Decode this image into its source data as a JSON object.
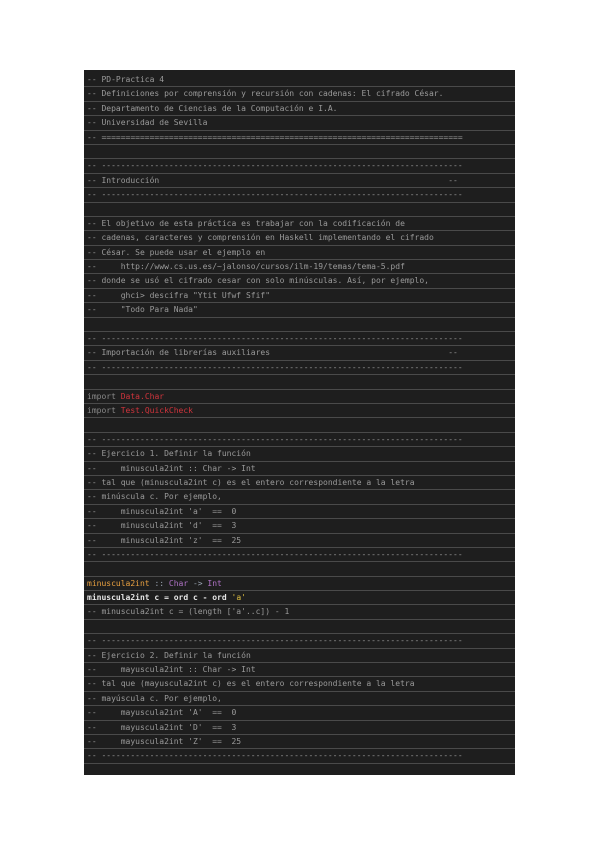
{
  "lines": [
    {
      "type": "comment",
      "text": "-- PD-Practica 4"
    },
    {
      "type": "comment",
      "text": "-- Definiciones por comprensión y recursión con cadenas: El cifrado César."
    },
    {
      "type": "comment",
      "text": "-- Departamento de Ciencias de la Computación e I.A."
    },
    {
      "type": "comment",
      "text": "-- Universidad de Sevilla"
    },
    {
      "type": "comment",
      "text": "-- ==========================================================================="
    },
    {
      "type": "blank",
      "text": ""
    },
    {
      "type": "comment",
      "text": "-- ---------------------------------------------------------------------------"
    },
    {
      "type": "comment",
      "text": "-- Introducción                                                            --"
    },
    {
      "type": "comment",
      "text": "-- ---------------------------------------------------------------------------"
    },
    {
      "type": "blank",
      "text": ""
    },
    {
      "type": "comment",
      "text": "-- El objetivo de esta práctica es trabajar con la codificación de"
    },
    {
      "type": "comment",
      "text": "-- cadenas, caracteres y comprensión en Haskell implementando el cifrado"
    },
    {
      "type": "comment",
      "text": "-- César. Se puede usar el ejemplo en"
    },
    {
      "type": "comment",
      "text": "--     http://www.cs.us.es/~jalonso/cursos/ilm-19/temas/tema-5.pdf"
    },
    {
      "type": "comment",
      "text": "-- donde se usó el cifrado cesar con solo minúsculas. Así, por ejemplo,"
    },
    {
      "type": "comment",
      "text": "--     ghci> descifra \"Ytit Ufwf Sfif\""
    },
    {
      "type": "comment",
      "text": "--     \"Todo Para Nada\""
    },
    {
      "type": "blank",
      "text": ""
    },
    {
      "type": "comment",
      "text": "-- ---------------------------------------------------------------------------"
    },
    {
      "type": "comment",
      "text": "-- Importación de librerías auxiliares                                     --"
    },
    {
      "type": "comment",
      "text": "-- ---------------------------------------------------------------------------"
    },
    {
      "type": "blank",
      "text": ""
    },
    {
      "type": "import",
      "keyword": "import",
      "module": "Data.Char"
    },
    {
      "type": "import",
      "keyword": "import",
      "module": "Test.QuickCheck"
    },
    {
      "type": "blank",
      "text": ""
    },
    {
      "type": "comment",
      "text": "-- ---------------------------------------------------------------------------"
    },
    {
      "type": "comment",
      "text": "-- Ejercicio 1. Definir la función"
    },
    {
      "type": "comment",
      "text": "--     minuscula2int :: Char -> Int"
    },
    {
      "type": "comment",
      "text": "-- tal que (minuscula2int c) es el entero correspondiente a la letra"
    },
    {
      "type": "comment",
      "text": "-- minúscula c. Por ejemplo,"
    },
    {
      "type": "comment",
      "text": "--     minuscula2int 'a'  ==  0"
    },
    {
      "type": "comment",
      "text": "--     minuscula2int 'd'  ==  3"
    },
    {
      "type": "comment",
      "text": "--     minuscula2int 'z'  ==  25"
    },
    {
      "type": "comment",
      "text": "-- ---------------------------------------------------------------------------"
    },
    {
      "type": "blank",
      "text": ""
    },
    {
      "type": "signature",
      "name": "minuscula2int",
      "op": " :: ",
      "arg": "Char",
      "arrow": " -> ",
      "ret": "Int"
    },
    {
      "type": "definition",
      "lhs": "minuscula2int c = ord c - ord ",
      "lit": "'a'"
    },
    {
      "type": "comment",
      "text": "-- minuscula2int c = (length ['a'..c]) - 1"
    },
    {
      "type": "blank",
      "text": ""
    },
    {
      "type": "comment",
      "text": "-- ---------------------------------------------------------------------------"
    },
    {
      "type": "comment",
      "text": "-- Ejercicio 2. Definir la función"
    },
    {
      "type": "comment",
      "text": "--     mayuscula2int :: Char -> Int"
    },
    {
      "type": "comment",
      "text": "-- tal que (mayuscula2int c) es el entero correspondiente a la letra"
    },
    {
      "type": "comment",
      "text": "-- mayúscula c. Por ejemplo,"
    },
    {
      "type": "comment",
      "text": "--     mayuscula2int 'A'  ==  0"
    },
    {
      "type": "comment",
      "text": "--     mayuscula2int 'D'  ==  3"
    },
    {
      "type": "comment",
      "text": "--     mayuscula2int 'Z'  ==  25"
    },
    {
      "type": "comment",
      "text": "-- ---------------------------------------------------------------------------"
    }
  ]
}
